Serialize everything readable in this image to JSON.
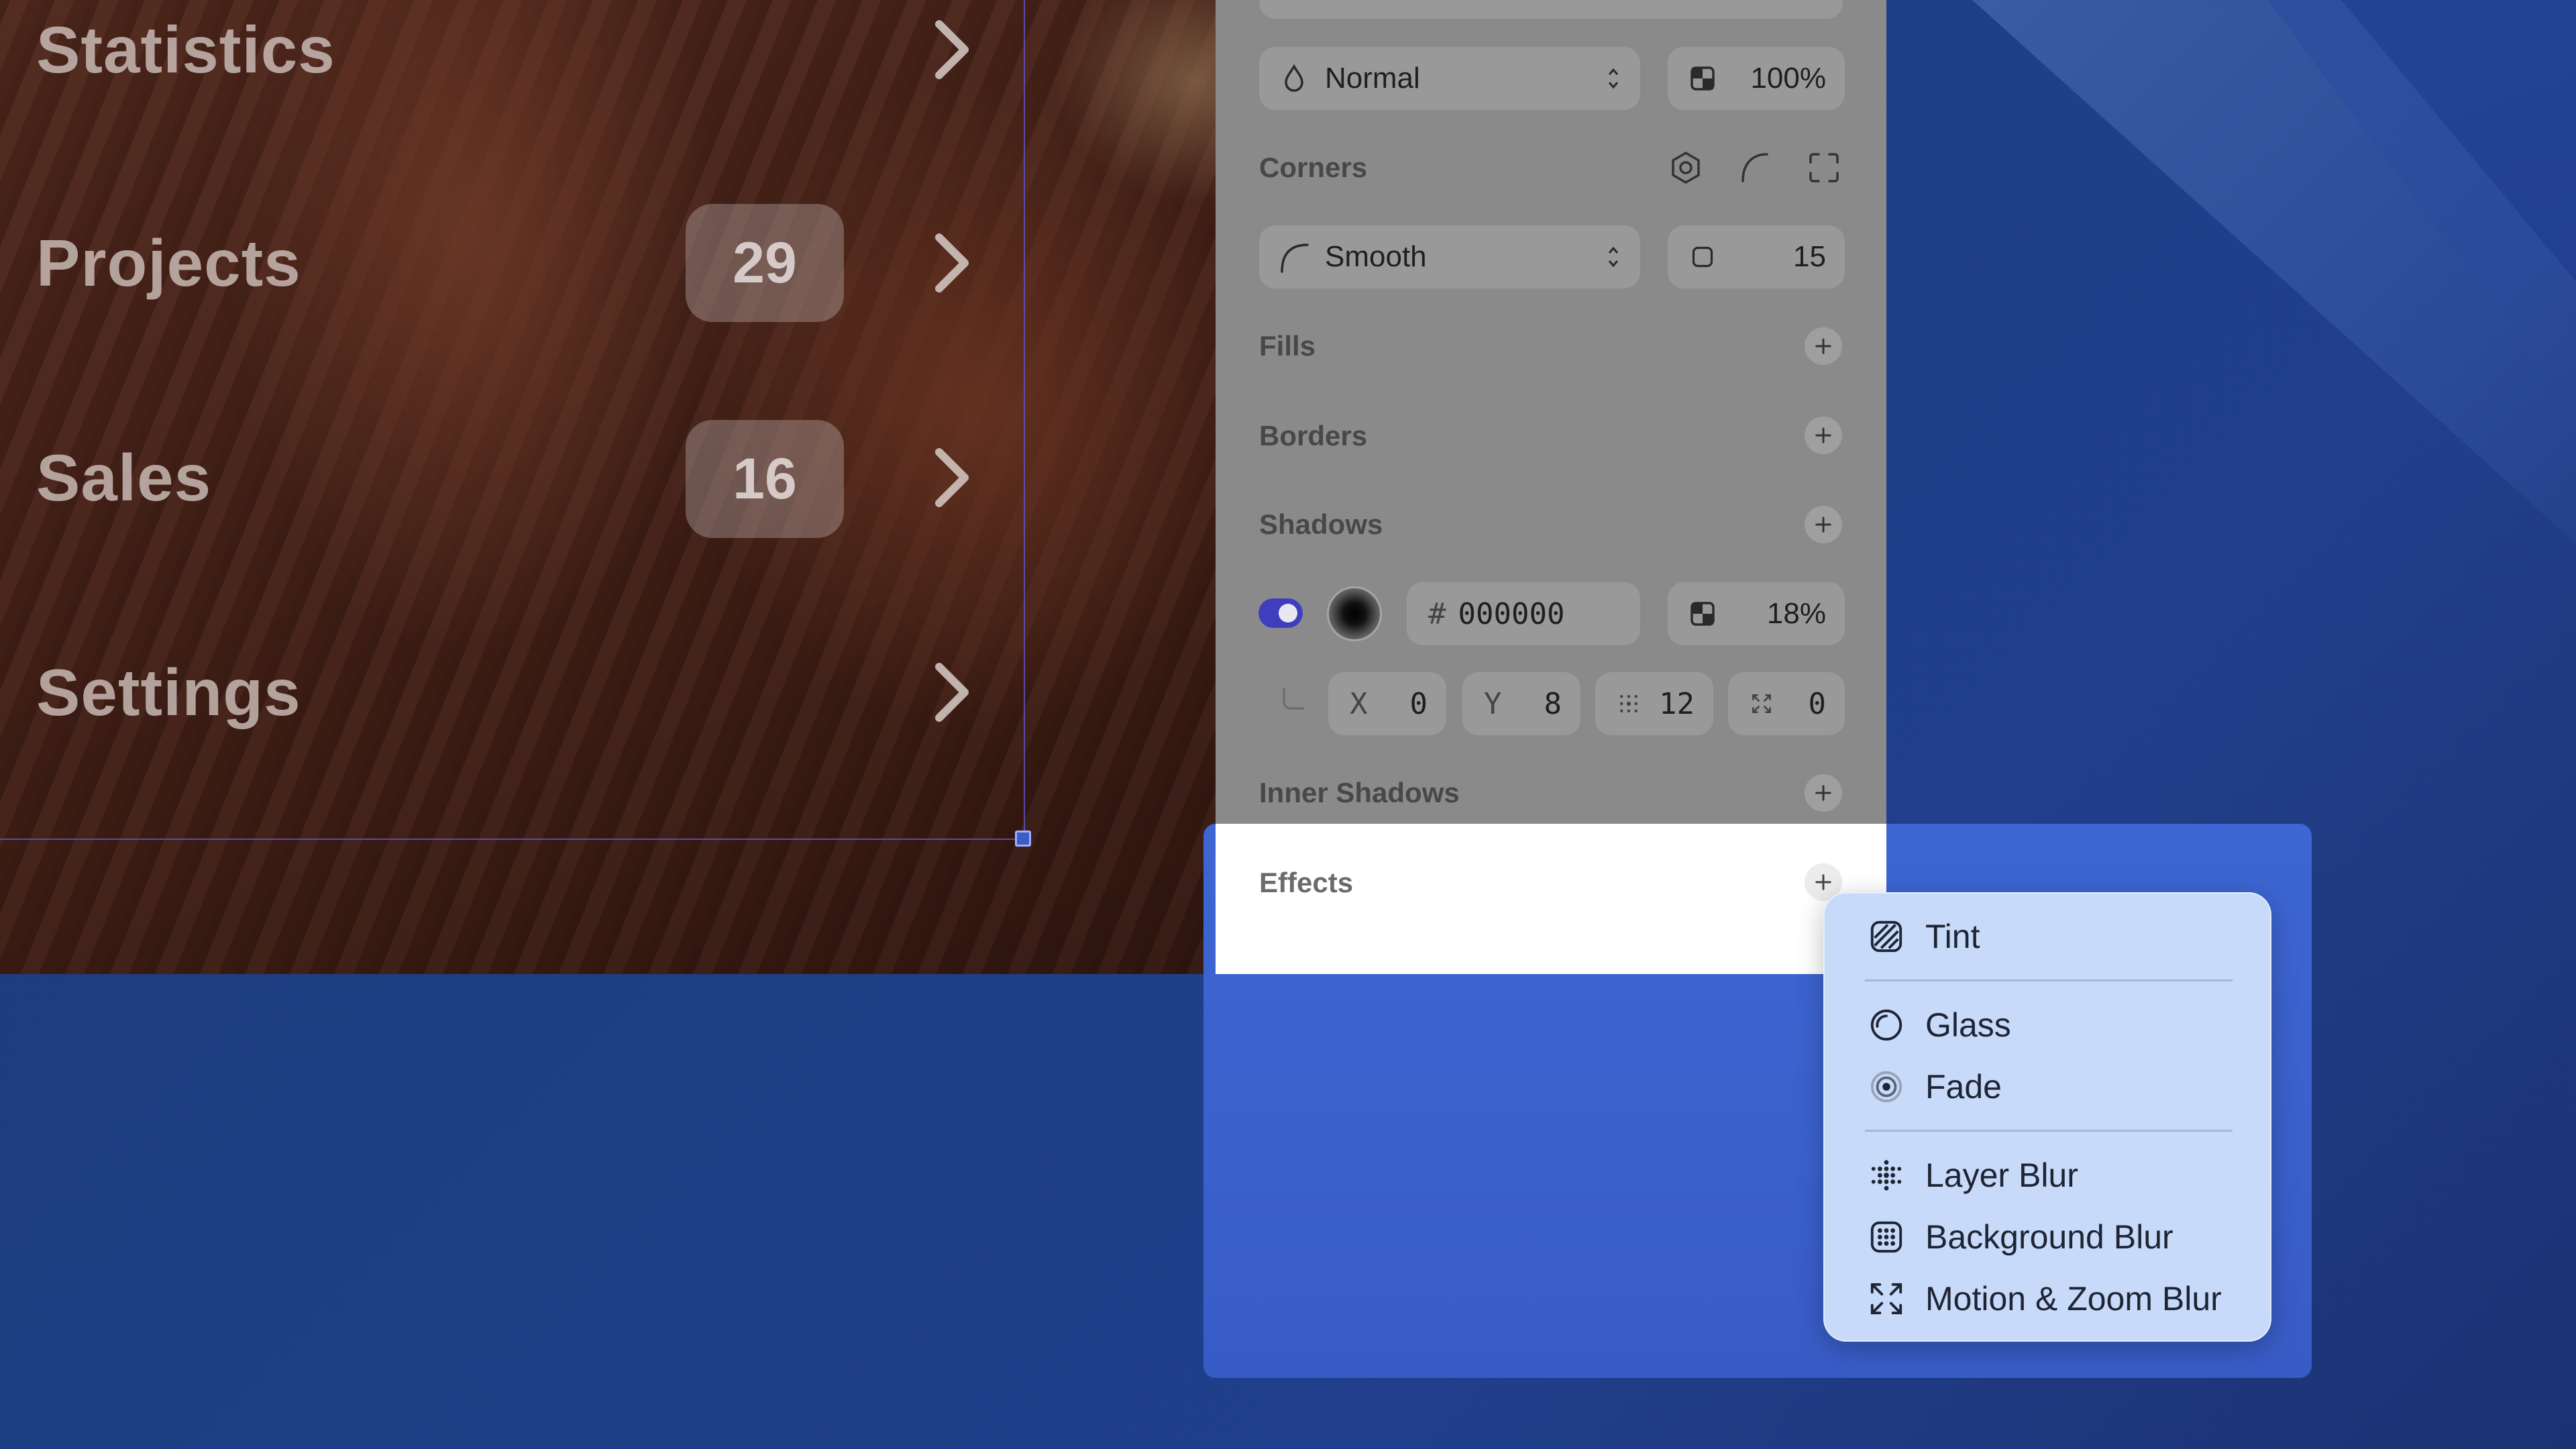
{
  "canvas": {
    "menu": [
      {
        "label": "Statistics",
        "badge": null
      },
      {
        "label": "Projects",
        "badge": "29"
      },
      {
        "label": "Sales",
        "badge": "16"
      },
      {
        "label": "Settings",
        "badge": null
      }
    ]
  },
  "inspector": {
    "blend_mode": "Normal",
    "opacity": "100%",
    "corners": {
      "title": "Corners",
      "style": "Smooth",
      "radius": "15"
    },
    "sections": {
      "fills": "Fills",
      "borders": "Borders",
      "shadows": "Shadows",
      "inner_shadows": "Inner Shadows",
      "effects": "Effects"
    },
    "shadow": {
      "enabled": true,
      "hash": "#",
      "color_hex": "000000",
      "opacity": "18%",
      "x_label": "X",
      "x": "0",
      "y_label": "Y",
      "y": "8",
      "blur": "12",
      "spread": "0"
    }
  },
  "effects_menu": {
    "items": [
      {
        "label": "Tint",
        "icon": "tint-icon"
      },
      {
        "label": "Glass",
        "icon": "glass-icon"
      },
      {
        "label": "Fade",
        "icon": "fade-icon"
      },
      {
        "label": "Layer Blur",
        "icon": "layer-blur-icon"
      },
      {
        "label": "Background Blur",
        "icon": "background-blur-icon"
      },
      {
        "label": "Motion & Zoom Blur",
        "icon": "motion-zoom-blur-icon"
      }
    ]
  },
  "colors": {
    "toggle_on": "#3f3fbe",
    "dropdown_bg": "#c7daf9",
    "panel_bg": "#8a8a8a",
    "accent_blue": "#3c63cf"
  }
}
